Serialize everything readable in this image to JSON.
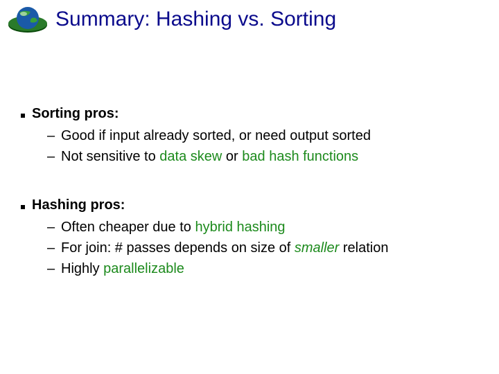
{
  "title": "Summary: Hashing vs. Sorting",
  "sections": [
    {
      "heading": "Sorting pros:",
      "items": [
        {
          "pre": "Good if input already sorted, or need output sorted",
          "hi": "",
          "post": ""
        },
        {
          "pre": "Not sensitive to ",
          "hi": "data skew",
          "mid": " or ",
          "hi2": "bad hash functions",
          "post": ""
        }
      ]
    },
    {
      "heading": "Hashing pros:",
      "items": [
        {
          "pre": "Often cheaper due to ",
          "hi": "hybrid hashing",
          "post": ""
        },
        {
          "pre": "For join: # passes depends on size of ",
          "hi": "smaller",
          "hi_italic": true,
          "post": " relation"
        },
        {
          "pre": "Highly ",
          "hi": "parallelizable",
          "post": ""
        }
      ]
    }
  ],
  "dash": "–"
}
